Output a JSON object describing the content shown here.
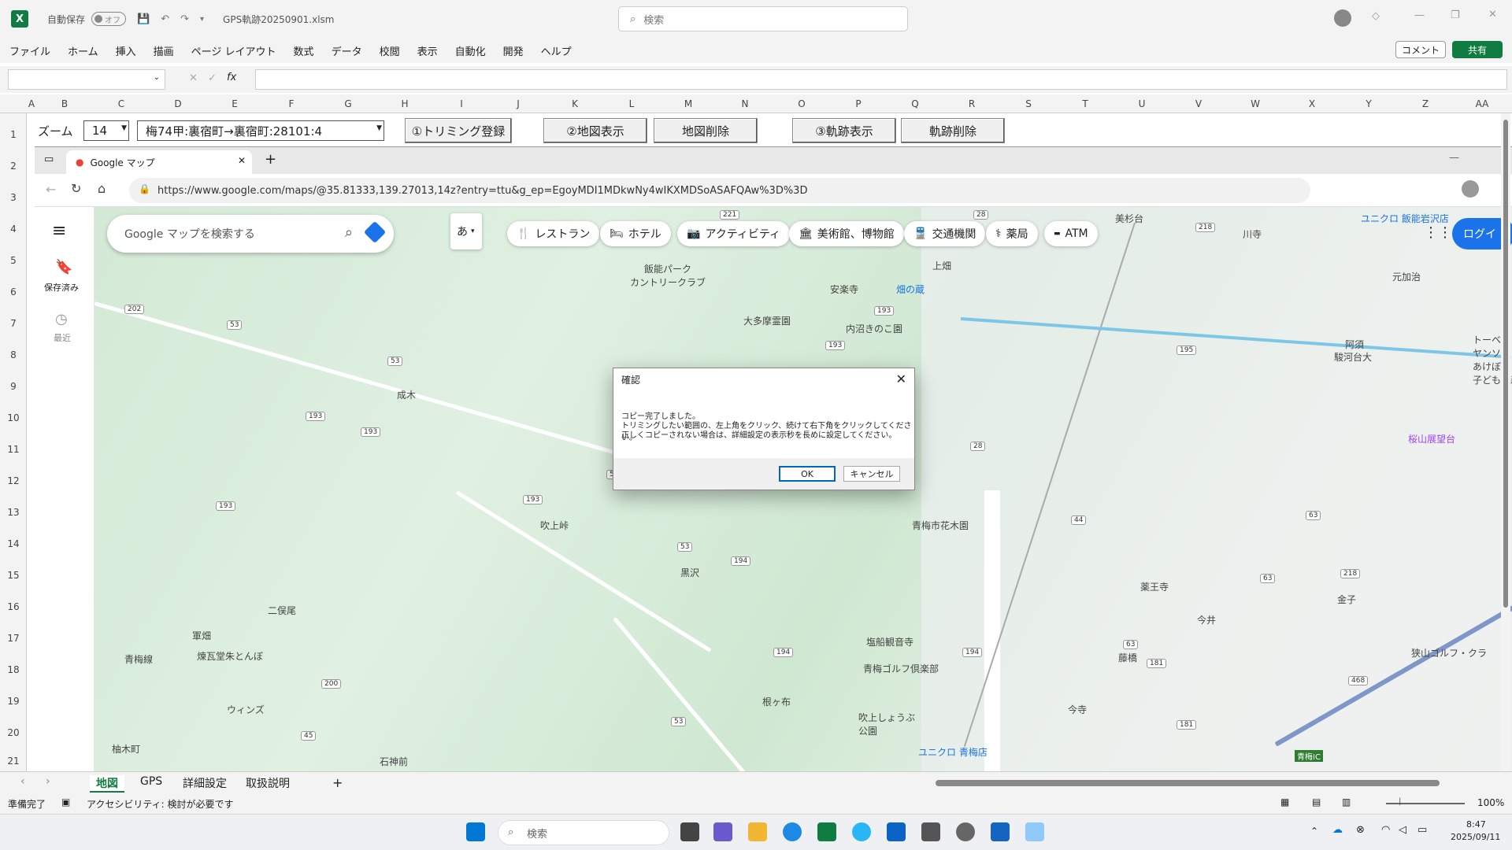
{
  "titlebar": {
    "autosave_label": "自動保存",
    "autosave_state": "オフ",
    "filename": "GPS軌跡20250901.xlsm",
    "search_placeholder": "検索"
  },
  "menu": [
    "ファイル",
    "ホーム",
    "挿入",
    "描画",
    "ページ レイアウト",
    "数式",
    "データ",
    "校閲",
    "表示",
    "自動化",
    "開発",
    "ヘルプ"
  ],
  "comment_label": "コメント",
  "share_label": "共有",
  "fx_label": "fx",
  "columns": [
    "A",
    "B",
    "C",
    "D",
    "E",
    "F",
    "G",
    "H",
    "I",
    "J",
    "K",
    "L",
    "M",
    "N",
    "O",
    "P",
    "Q",
    "R",
    "S",
    "T",
    "U",
    "V",
    "W",
    "X",
    "Y",
    "Z",
    "AA"
  ],
  "rows": [
    "1",
    "2",
    "3",
    "4",
    "5",
    "6",
    "7",
    "8",
    "9",
    "10",
    "11",
    "12",
    "13",
    "14",
    "15",
    "16",
    "17",
    "18",
    "19",
    "20",
    "21"
  ],
  "sheet_controls": {
    "zoom_label": "ズーム",
    "zoom_value": "14",
    "location_value": "梅74甲:裏宿町→裏宿町:28101:4",
    "btn_trim": "①トリミング登録",
    "btn_map_show": "②地図表示",
    "btn_map_delete": "地図削除",
    "btn_track_show": "③軌跡表示",
    "btn_track_delete": "軌跡削除"
  },
  "browser": {
    "tab_title": "Google マップ",
    "url": "https://www.google.com/maps/@35.81333,139.27013,14z?entry=ttu&g_ep=EgoyMDI1MDkwNy4wIKXMDSoASAFQAw%3D%3D"
  },
  "maps": {
    "search_placeholder": "Google マップを検索する",
    "lang_button": "あ",
    "chips": [
      "レストラン",
      "ホテル",
      "アクティビティ",
      "美術館、博物館",
      "交通機関",
      "薬局",
      "ATM"
    ],
    "rail_saved": "保存済み",
    "rail_recent": "最近",
    "login": "ログイ",
    "labels": [
      "飯能パーク\nカントリークラブ",
      "安楽寺",
      "畑の蔵",
      "大多摩霊園",
      "内沼きのこ園",
      "上畑",
      "美杉台",
      "川寺",
      "元加治",
      "ユニクロ 飯能岩沢店",
      "阿須",
      "駿河台大",
      "桜山展望台",
      "成木",
      "吹上峠",
      "黒沢",
      "二俣尾",
      "軍畑",
      "青梅線",
      "煉瓦堂朱とんぼ",
      "ウィンズ",
      "柚木町",
      "石神前",
      "青梅市花木園",
      "薬王寺",
      "今井",
      "金子",
      "塩船観音寺",
      "青梅ゴルフ倶楽部",
      "根ヶ布",
      "吹上しょうぶ\n公園",
      "ユニクロ 青梅店",
      "藤橋",
      "今寺",
      "狭山ゴルフ・クラ",
      "青梅IC",
      "トーベ・\nヤンソン\nあけぼの\n子どもの森"
    ],
    "shields": [
      "221",
      "202",
      "53",
      "53",
      "193",
      "193",
      "193",
      "53",
      "193",
      "193",
      "193",
      "53",
      "194",
      "28",
      "195",
      "28",
      "44",
      "63",
      "63",
      "218",
      "63",
      "181",
      "181",
      "200",
      "45",
      "53",
      "194",
      "194",
      "468",
      "218"
    ]
  },
  "dialog": {
    "title": "確認",
    "line1": "コピー完了しました。",
    "line2": "トリミングしたい範囲の、左上角をクリック、続けて右下角をクリックしてください。",
    "line3": "正しくコピーされない場合は、詳細設定の表示秒を長めに設定してください。",
    "ok": "OK",
    "cancel": "キャンセル"
  },
  "sheet_tabs": [
    "地図",
    "GPS",
    "詳細設定",
    "取扱説明"
  ],
  "status": {
    "ready": "準備完了",
    "accessibility": "アクセシビリティ: 検討が必要です",
    "zoom": "100%"
  },
  "taskbar": {
    "search_placeholder": "検索",
    "time": "8:47",
    "date": "2025/09/11"
  }
}
